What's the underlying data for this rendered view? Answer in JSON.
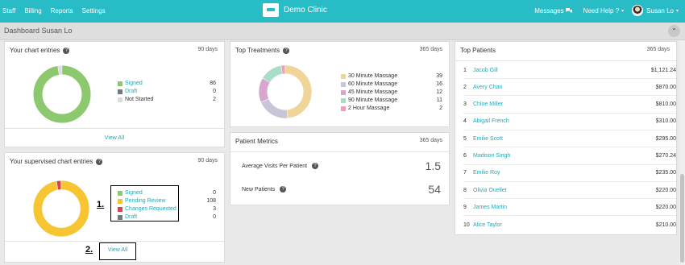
{
  "topbar": {
    "nav": [
      "Staff",
      "Billing",
      "Reports",
      "Settings"
    ],
    "app_title": "Demo Clinic",
    "messages": "Messages",
    "help": "Need Help ?",
    "user": "Susan Lo"
  },
  "subbar": {
    "breadcrumb": "Dashboard  Susan Lo"
  },
  "chart_entries": {
    "title": "Your chart entries",
    "range": "90 days",
    "items": [
      {
        "label": "Signed",
        "value": "86",
        "color": "#8cc96e"
      },
      {
        "label": "Draft",
        "value": "0",
        "color": "#6f7b85"
      },
      {
        "label": "Not Started",
        "value": "2",
        "color": "#dcdcdc"
      }
    ],
    "footer": "View All"
  },
  "supervised": {
    "title": "Your supervised chart entries",
    "range": "90 days",
    "items": [
      {
        "label": "Signed",
        "value": "0",
        "color": "#8cc96e"
      },
      {
        "label": "Pending Review",
        "value": "108",
        "color": "#f7c531"
      },
      {
        "label": "Changes Requested",
        "value": "3",
        "color": "#d9424f"
      },
      {
        "label": "Draft",
        "value": "0",
        "color": "#6f7b85"
      }
    ],
    "footer": "View All",
    "annotation1": "1.",
    "annotation2": "2."
  },
  "treatments": {
    "title": "Top Treatments",
    "range": "365 days",
    "items": [
      {
        "label": "30 Minute Massage",
        "value": "39",
        "color": "#f0d59a"
      },
      {
        "label": "60 Minute Massage",
        "value": "16",
        "color": "#c9c5d6"
      },
      {
        "label": "45 Minute Massage",
        "value": "12",
        "color": "#d7a6cf"
      },
      {
        "label": "90 Minute Massage",
        "value": "11",
        "color": "#a9ddc6"
      },
      {
        "label": "2 Hour Massage",
        "value": "2",
        "color": "#ee9fb6"
      }
    ]
  },
  "metrics": {
    "title": "Patient Metrics",
    "range": "365 days",
    "rows": [
      {
        "label": "Average Visits Per Patient",
        "value": "1.5"
      },
      {
        "label": "New Patients",
        "value": "54"
      }
    ]
  },
  "patients": {
    "title": "Top Patients",
    "range": "365 days",
    "rows": [
      {
        "n": "1",
        "name": "Jacob Gill",
        "amount": "$1,121.24"
      },
      {
        "n": "2",
        "name": "Avery Chan",
        "amount": "$870.00"
      },
      {
        "n": "3",
        "name": "Chloe Miller",
        "amount": "$810.00"
      },
      {
        "n": "4",
        "name": "Abigail French",
        "amount": "$310.00"
      },
      {
        "n": "5",
        "name": "Emilie Scott",
        "amount": "$295.00"
      },
      {
        "n": "6",
        "name": "Madison Singh",
        "amount": "$270.24"
      },
      {
        "n": "7",
        "name": "Emilie Roy",
        "amount": "$235.00"
      },
      {
        "n": "8",
        "name": "Olivia Ouellet",
        "amount": "$220.00"
      },
      {
        "n": "9",
        "name": "James Martin",
        "amount": "$220.00"
      },
      {
        "n": "10",
        "name": "Alice Taylor",
        "amount": "$210.00"
      }
    ]
  }
}
